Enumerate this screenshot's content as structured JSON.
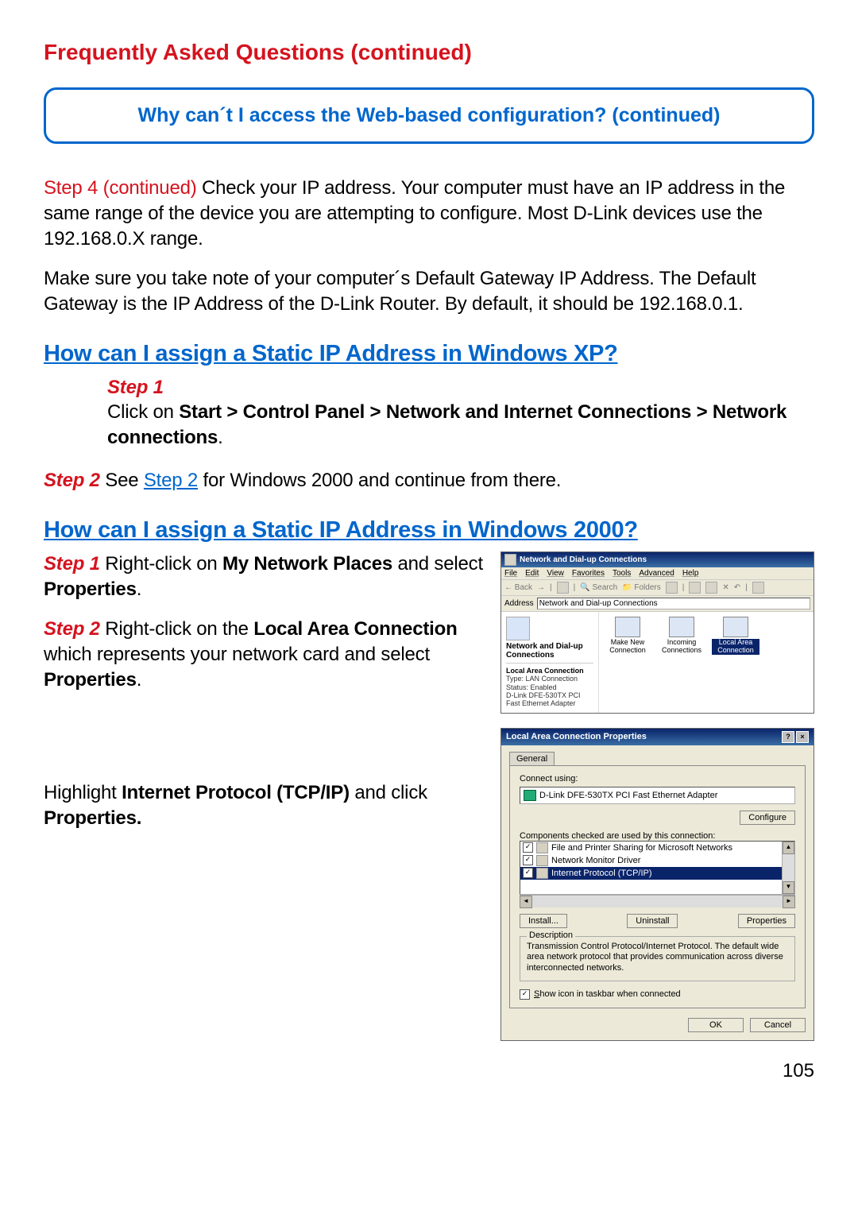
{
  "faq_title": "Frequently Asked Questions (continued)",
  "question_box": "Why can´t I access the Web-based configuration? (continued)",
  "para1_prefix": "Step 4  (continued) ",
  "para1_rest": "Check your IP address. Your computer must have an IP address in the same range of the device you are attempting to configure. Most D-Link devices use the 192.168.0.X range.",
  "para2": "Make sure you take note of your computer´s Default Gateway IP Address. The Default Gateway is the IP Address of the D-Link Router. By default, it should be 192.168.0.1.",
  "h_xp": "How can I assign a Static IP Address in Windows XP?",
  "xp_step1_label": "Step 1",
  "xp_step1_pre": "Click on ",
  "xp_step1_bold": "Start > Control Panel > Network and Internet Connections > Network connections",
  "xp_step1_post": ".",
  "xp_step2_label": "Step 2 ",
  "xp_step2_a": "See ",
  "xp_step2_link": "Step 2",
  "xp_step2_b": " for Windows 2000 and continue from there.",
  "h_2000": "How can I assign a Static IP Address in Windows 2000?",
  "w2k_s1_label": "Step 1 ",
  "w2k_s1_a": "Right-click on ",
  "w2k_s1_bold1": "My Network Places",
  "w2k_s1_b": " and select ",
  "w2k_s1_bold2": "Properties",
  "w2k_s1_c": ".",
  "w2k_s2_label": "Step 2 ",
  "w2k_s2_a": "Right-click on the ",
  "w2k_s2_bold1": "Local Area Connection",
  "w2k_s2_b": " which represents your network card and select ",
  "w2k_s2_bold2": "Properties",
  "w2k_s2_c": ".",
  "w2k_s3_a": "Highlight ",
  "w2k_s3_bold1": "Internet Protocol (TCP/IP)",
  "w2k_s3_b": " and click ",
  "w2k_s3_bold2": "Properties.",
  "page_number": "105",
  "scr1": {
    "title": "Network and Dial-up Connections",
    "menus": [
      "File",
      "Edit",
      "View",
      "Favorites",
      "Tools",
      "Advanced",
      "Help"
    ],
    "nav_back": "Back",
    "search": "Search",
    "folders": "Folders",
    "address_label": "Address",
    "address_value": "Network and Dial-up Connections",
    "left_title": "Network and Dial-up Connections",
    "detail_title": "Local Area Connection",
    "detail_type": "Type: LAN Connection",
    "detail_status": "Status: Enabled",
    "detail_adapter": "D-Link DFE-530TX PCI Fast Ethernet Adapter",
    "items": [
      {
        "label": "Make New Connection"
      },
      {
        "label": "Incoming Connections"
      },
      {
        "label": "Local Area Connection",
        "selected": true
      }
    ]
  },
  "scr2": {
    "title": "Local Area Connection Properties",
    "tab": "General",
    "connect_using": "Connect using:",
    "adapter": "D-Link DFE-530TX PCI Fast Ethernet Adapter",
    "configure": "Configure",
    "components_label": "Components checked are used by this connection:",
    "components": [
      {
        "label": "File and Printer Sharing for Microsoft Networks",
        "checked": true
      },
      {
        "label": "Network Monitor Driver",
        "checked": true
      },
      {
        "label": "Internet Protocol (TCP/IP)",
        "checked": true,
        "selected": true
      }
    ],
    "install": "Install...",
    "uninstall": "Uninstall",
    "properties": "Properties",
    "desc_legend": "Description",
    "desc_text": "Transmission Control Protocol/Internet Protocol. The default wide area network protocol that provides communication across diverse interconnected networks.",
    "show_icon": "Show icon in taskbar when connected",
    "ok": "OK",
    "cancel": "Cancel"
  }
}
